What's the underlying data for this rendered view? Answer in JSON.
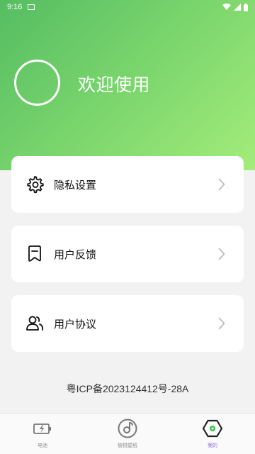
{
  "status_bar": {
    "time": "9:16"
  },
  "header": {
    "welcome_text": "欢迎使用"
  },
  "menu": [
    {
      "label": "隐私设置",
      "icon": "gear-icon"
    },
    {
      "label": "用户反馈",
      "icon": "bookmark-feedback-icon"
    },
    {
      "label": "用户协议",
      "icon": "users-agreement-icon"
    }
  ],
  "footer": {
    "icp": "粤ICP备2023124412号-28A"
  },
  "tabs": [
    {
      "label": "电池",
      "icon": "battery-charging-icon",
      "active": false
    },
    {
      "label": "愉悦壁纸",
      "icon": "music-disc-icon",
      "active": false
    },
    {
      "label": "我的",
      "icon": "hexagon-profile-icon",
      "active": true
    }
  ],
  "colors": {
    "gradient_start": "#55bd62",
    "gradient_end": "#a4ec7a",
    "accent": "#8b6cd8",
    "active_icon": "#37c24a"
  }
}
